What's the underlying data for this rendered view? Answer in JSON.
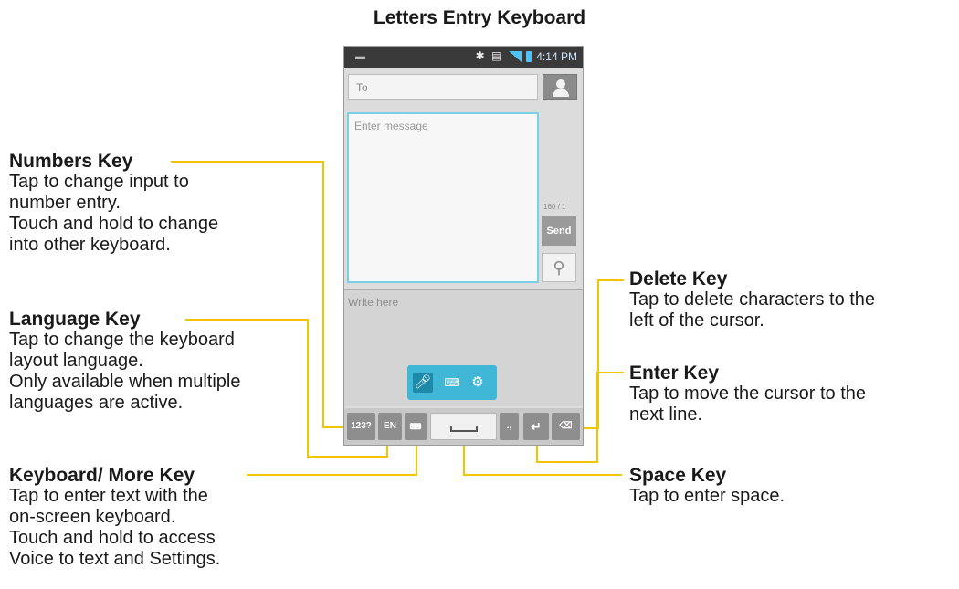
{
  "title": "Letters Entry Keyboard",
  "phone": {
    "status_time": "4:14 PM",
    "to_placeholder": "To",
    "message_placeholder": "Enter message",
    "counter": "160 / 1",
    "send_label": "Send",
    "write_placeholder": "Write here",
    "keys": {
      "numbers": "123?",
      "language": "EN",
      "punctuation": ".,",
      "enter": "↵",
      "delete": "⌫"
    }
  },
  "callouts": {
    "numbers": {
      "title": "Numbers Key",
      "desc": "Tap to change input to\nnumber entry.\nTouch and hold to change\ninto other keyboard."
    },
    "language": {
      "title": "Language Key",
      "desc": "Tap to change the keyboard\nlayout language.\nOnly available when multiple\nlanguages are active."
    },
    "keyboard_more": {
      "title": "Keyboard/ More Key",
      "desc": "Tap to enter text with the\non-screen keyboard.\nTouch and hold to access\nVoice to text and Settings."
    },
    "delete": {
      "title": "Delete Key",
      "desc": "Tap to delete characters to the\nleft of the cursor."
    },
    "enter": {
      "title": "Enter Key",
      "desc": "Tap to move the cursor to the\nnext line."
    },
    "space": {
      "title": "Space Key",
      "desc": "Tap to enter space."
    }
  },
  "colors": {
    "leader": "#f2c500",
    "accent": "#41b7d8",
    "highlight": "#7ad0e8"
  },
  "icons": {
    "contact": "person-icon",
    "attach": "paperclip-icon",
    "mic": "microphone-icon",
    "keyboard": "keyboard-icon",
    "settings": "gear-icon"
  }
}
